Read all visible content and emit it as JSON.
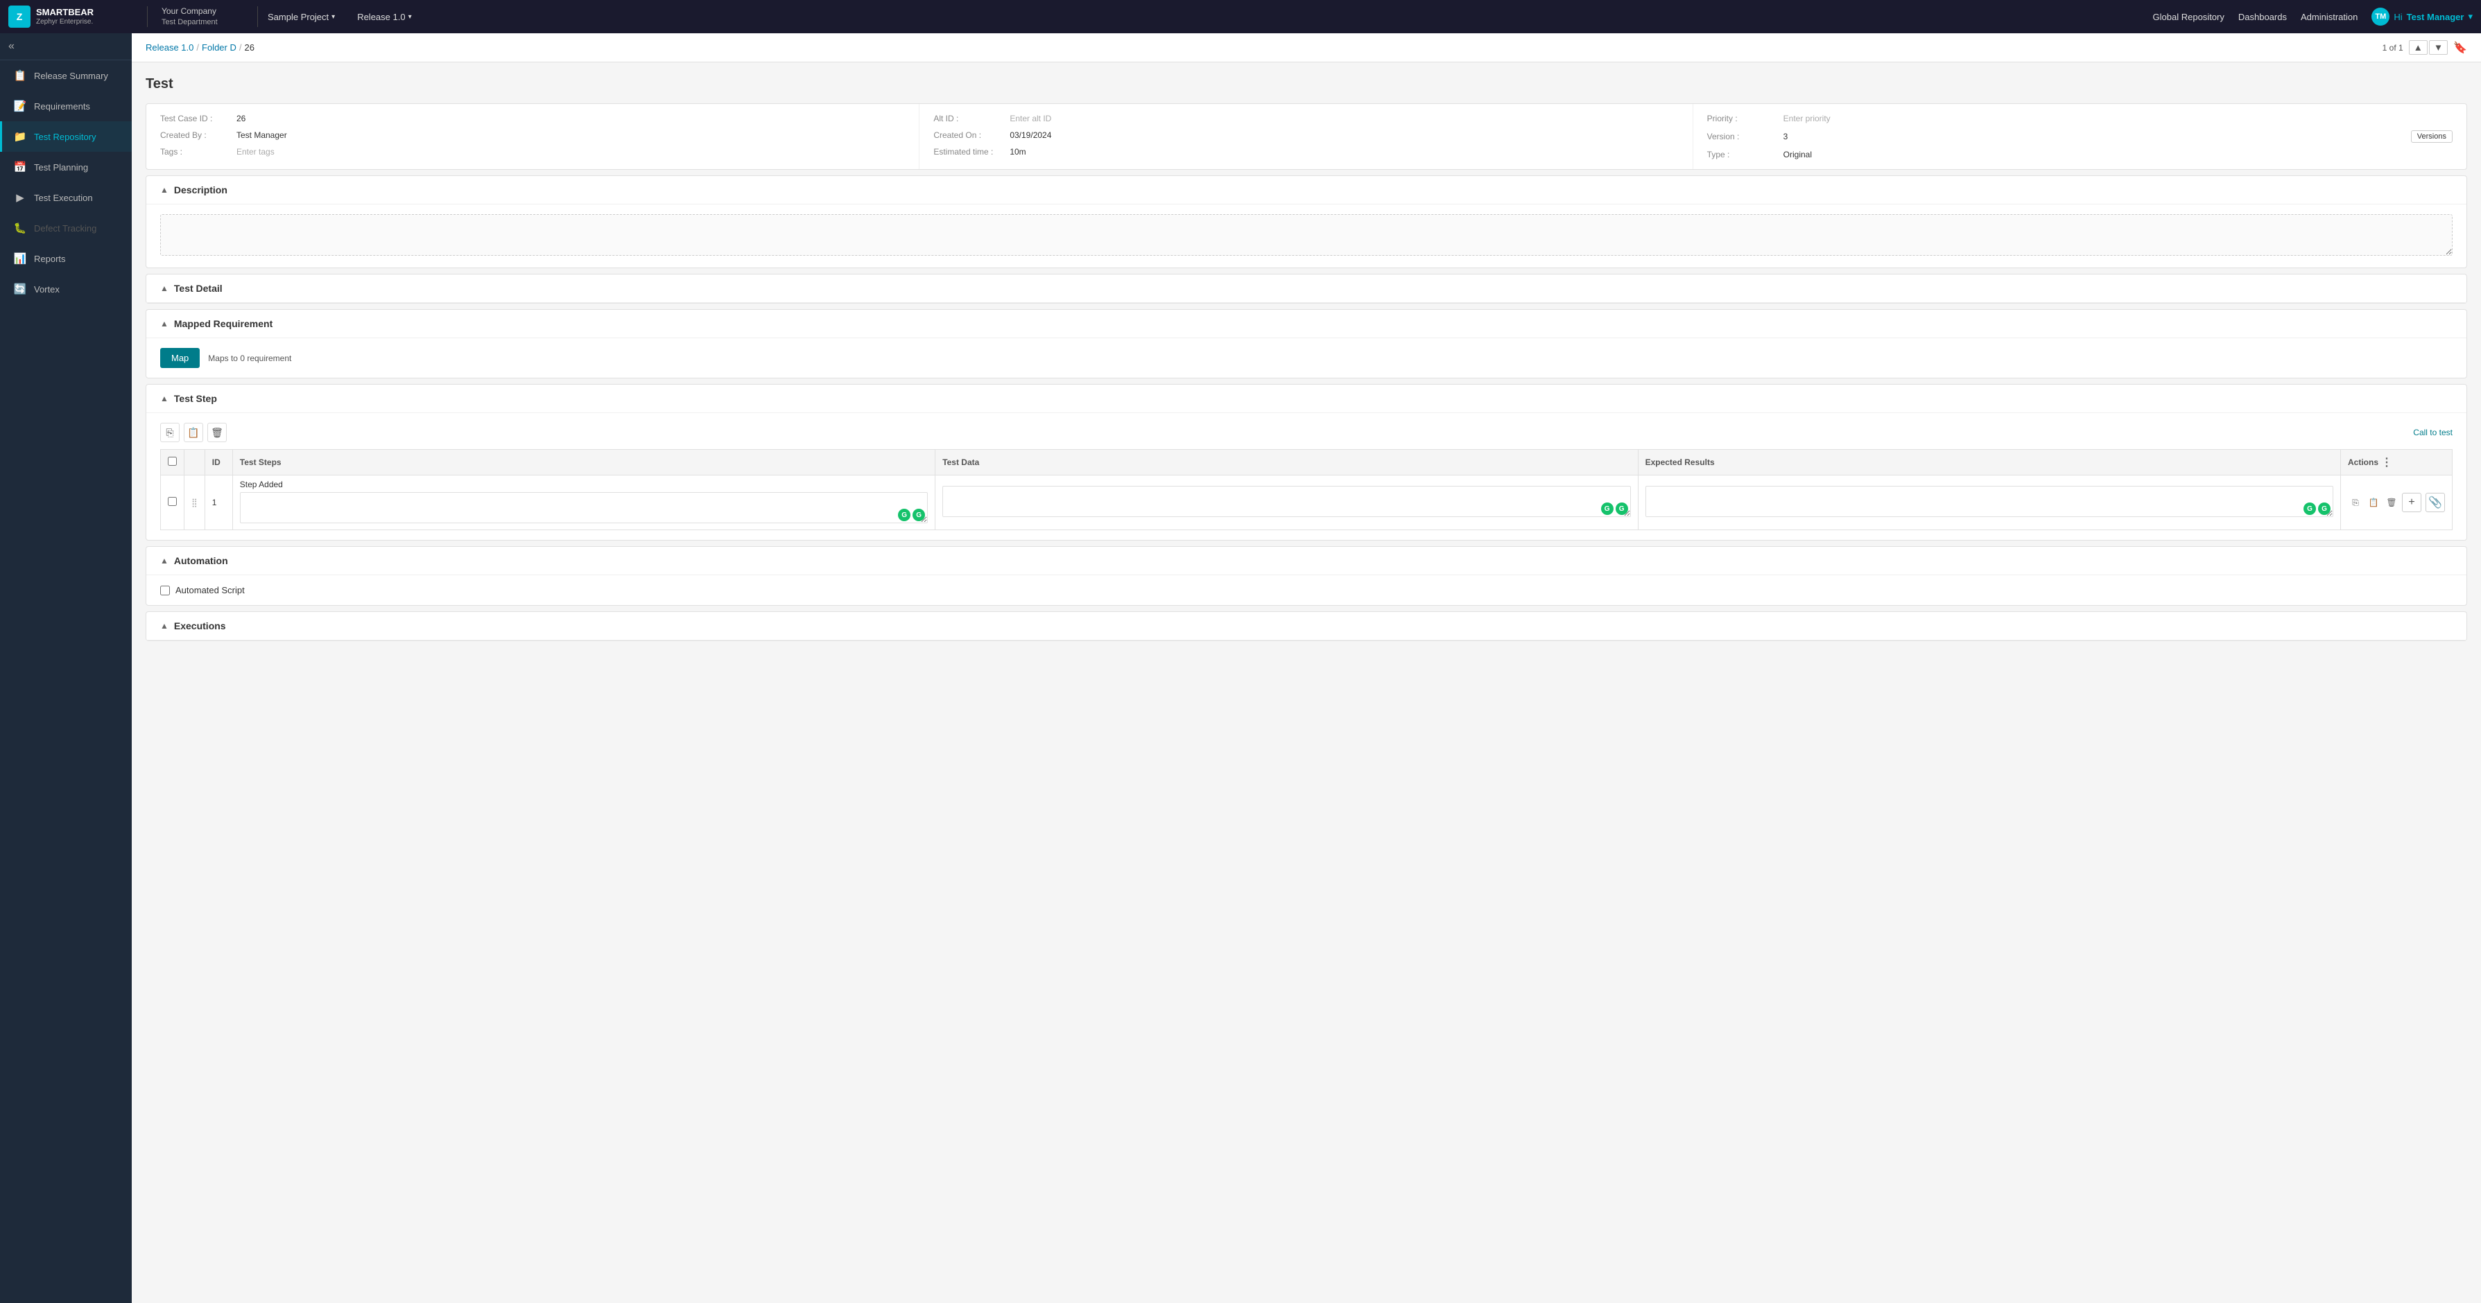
{
  "app": {
    "brand": "SMARTBEAR",
    "product": "Zephyr Enterprise.",
    "tagline": ""
  },
  "company": {
    "name": "Your Company",
    "department": "Test Department"
  },
  "topnav": {
    "project_label": "Sample Project",
    "release_label": "Release 1.0",
    "global_repository": "Global Repository",
    "dashboards": "Dashboards",
    "administration": "Administration",
    "user_greeting": "Hi",
    "user_name": "Test Manager"
  },
  "sidebar": {
    "toggle": "«",
    "items": [
      {
        "id": "release-summary",
        "label": "Release Summary",
        "icon": "📋",
        "active": false
      },
      {
        "id": "requirements",
        "label": "Requirements",
        "icon": "📝",
        "active": false
      },
      {
        "id": "test-repository",
        "label": "Test Repository",
        "icon": "📁",
        "active": true
      },
      {
        "id": "test-planning",
        "label": "Test Planning",
        "icon": "📅",
        "active": false
      },
      {
        "id": "test-execution",
        "label": "Test Execution",
        "icon": "▶",
        "active": false
      },
      {
        "id": "defect-tracking",
        "label": "Defect Tracking",
        "icon": "🐛",
        "active": false,
        "disabled": true
      },
      {
        "id": "reports",
        "label": "Reports",
        "icon": "📊",
        "active": false
      },
      {
        "id": "vortex",
        "label": "Vortex",
        "icon": "🔄",
        "active": false
      }
    ]
  },
  "breadcrumb": {
    "items": [
      "Release 1.0",
      "Folder D",
      "26"
    ],
    "pagination": "1 of 1"
  },
  "page": {
    "title": "Test"
  },
  "test_info": {
    "left": {
      "test_case_id_label": "Test Case ID :",
      "test_case_id_value": "26",
      "created_by_label": "Created By :",
      "created_by_value": "Test Manager",
      "tags_label": "Tags :",
      "tags_placeholder": "Enter tags"
    },
    "middle": {
      "alt_id_label": "Alt ID :",
      "alt_id_placeholder": "Enter alt ID",
      "created_on_label": "Created On :",
      "created_on_value": "03/19/2024",
      "estimated_time_label": "Estimated time :",
      "estimated_time_value": "10m"
    },
    "right": {
      "priority_label": "Priority :",
      "priority_placeholder": "Enter priority",
      "version_label": "Version :",
      "version_value": "3",
      "versions_btn": "Versions",
      "type_label": "Type :",
      "type_value": "Original"
    }
  },
  "sections": {
    "description": {
      "title": "Description",
      "placeholder": ""
    },
    "test_detail": {
      "title": "Test Detail"
    },
    "mapped_requirement": {
      "title": "Mapped Requirement",
      "map_btn": "Map",
      "maps_to_text": "Maps to 0 requirement"
    },
    "test_step": {
      "title": "Test Step",
      "call_to_test": "Call to test",
      "table": {
        "headers": [
          "",
          "",
          "ID",
          "Test Steps",
          "Test Data",
          "Expected Results",
          "Actions"
        ],
        "rows": [
          {
            "id": "1",
            "step": "Step Added",
            "test_data": "",
            "expected_results": ""
          }
        ]
      }
    },
    "automation": {
      "title": "Automation",
      "automated_script_label": "Automated Script"
    },
    "executions": {
      "title": "Executions"
    }
  }
}
